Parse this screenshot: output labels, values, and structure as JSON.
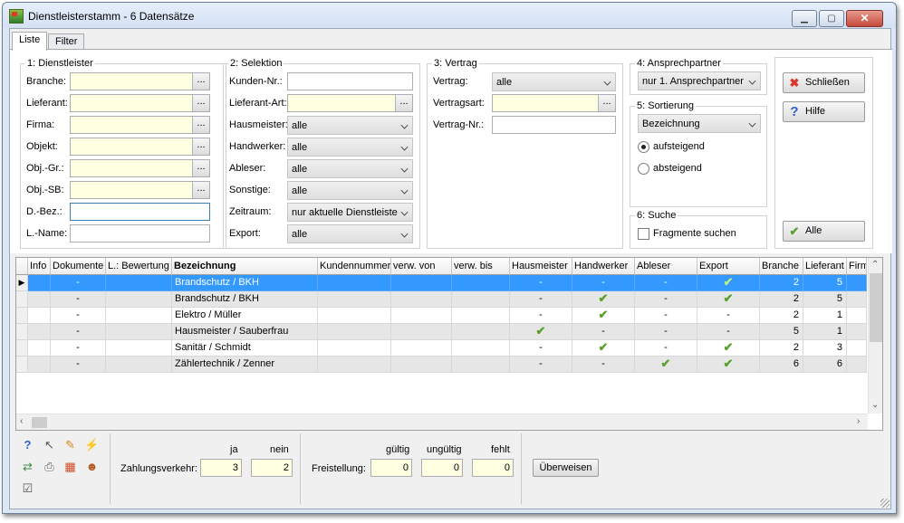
{
  "window": {
    "title": "Dienstleisterstamm - 6 Datensätze",
    "min": "▁",
    "max": "▢",
    "close": "✕"
  },
  "tabs": [
    "Liste",
    "Filter"
  ],
  "groups": {
    "dienstleister": {
      "legend": "1: Dienstleister",
      "fields": [
        {
          "label": "Branche:",
          "value": ""
        },
        {
          "label": "Lieferant:",
          "value": ""
        },
        {
          "label": "Firma:",
          "value": ""
        },
        {
          "label": "Objekt:",
          "value": ""
        },
        {
          "label": "Obj.-Gr.:",
          "value": ""
        },
        {
          "label": "Obj.-SB:",
          "value": ""
        },
        {
          "label": "D.-Bez.:",
          "value": ""
        },
        {
          "label": "L.-Name:",
          "value": ""
        }
      ]
    },
    "selektion": {
      "legend": "2: Selektion",
      "fields": [
        {
          "label": "Kunden-Nr.:",
          "value": ""
        },
        {
          "label": "Lieferant-Art:",
          "value": ""
        },
        {
          "label": "Hausmeister:",
          "value": "alle"
        },
        {
          "label": "Handwerker:",
          "value": "alle"
        },
        {
          "label": "Ableser:",
          "value": "alle"
        },
        {
          "label": "Sonstige:",
          "value": "alle"
        },
        {
          "label": "Zeitraum:",
          "value": "nur aktuelle Dienstleiste"
        },
        {
          "label": "Export:",
          "value": "alle"
        }
      ]
    },
    "vertrag": {
      "legend": "3: Vertrag",
      "fields": [
        {
          "label": "Vertrag:",
          "value": "alle"
        },
        {
          "label": "Vertragsart:",
          "value": ""
        },
        {
          "label": "Vertrag-Nr.:",
          "value": ""
        }
      ]
    },
    "ansprechpartner": {
      "legend": "4: Ansprechpartner",
      "value": "nur 1. Ansprechpartner"
    },
    "sortierung": {
      "legend": "5: Sortierung",
      "value": "Bezeichnung",
      "asc": "aufsteigend",
      "desc": "absteigend"
    },
    "suche": {
      "legend": "6: Suche",
      "checkbox": "Fragmente suchen"
    }
  },
  "buttons": {
    "close": "Schließen",
    "help": "Hilfe",
    "all": "Alle",
    "transfer": "Überweisen",
    "dots": "..."
  },
  "icons": {
    "close": "close-red-x-icon",
    "help": "help-question-icon",
    "all": "green-checkmark-icon"
  },
  "grid": {
    "columns": [
      "Info",
      "Dokumente",
      "L.: Bewertung",
      "Bezeichnung",
      "Kundennummer",
      "verw. von",
      "verw. bis",
      "Hausmeister",
      "Handwerker",
      "Ableser",
      "Export",
      "Branche",
      "Lieferant",
      "Firm"
    ],
    "rows": [
      {
        "info": "",
        "dok": "-",
        "bew": "",
        "bez": "Brandschutz / BKH",
        "kd": "",
        "von": "",
        "bis": "",
        "hm": "-",
        "hw": "-",
        "ab": "-",
        "ex": "✔",
        "br": "2",
        "lf": "5",
        "selected": true
      },
      {
        "info": "",
        "dok": "-",
        "bew": "",
        "bez": "Brandschutz / BKH",
        "kd": "",
        "von": "",
        "bis": "",
        "hm": "-",
        "hw": "✔",
        "ab": "-",
        "ex": "✔",
        "br": "2",
        "lf": "5"
      },
      {
        "info": "",
        "dok": "-",
        "bew": "",
        "bez": "Elektro / Müller",
        "kd": "",
        "von": "",
        "bis": "",
        "hm": "-",
        "hw": "✔",
        "ab": "-",
        "ex": "-",
        "br": "2",
        "lf": "1"
      },
      {
        "info": "",
        "dok": "-",
        "bew": "",
        "bez": "Hausmeister / Sauberfrau",
        "kd": "",
        "von": "",
        "bis": "",
        "hm": "✔",
        "hw": "-",
        "ab": "-",
        "ex": "-",
        "br": "5",
        "lf": "1"
      },
      {
        "info": "",
        "dok": "-",
        "bew": "",
        "bez": "Sanitär / Schmidt",
        "kd": "",
        "von": "",
        "bis": "",
        "hm": "-",
        "hw": "✔",
        "ab": "-",
        "ex": "✔",
        "br": "2",
        "lf": "3"
      },
      {
        "info": "",
        "dok": "-",
        "bew": "",
        "bez": "Zählertechnik / Zenner",
        "kd": "",
        "von": "",
        "bis": "",
        "hm": "-",
        "hw": "-",
        "ab": "✔",
        "ex": "✔",
        "br": "6",
        "lf": "6"
      }
    ]
  },
  "bottom": {
    "zahlungsverkehr": {
      "label": "Zahlungsverkehr:",
      "ja_label": "ja",
      "nein_label": "nein",
      "ja": "3",
      "nein": "2"
    },
    "freistellung": {
      "label": "Freistellung:",
      "gueltig_label": "gültig",
      "ungueltig_label": "ungültig",
      "fehlt_label": "fehlt",
      "gueltig": "0",
      "ungueltig": "0",
      "fehlt": "0"
    }
  },
  "toolbar_icons": [
    "help-icon",
    "pointer-icon",
    "pencil-icon",
    "lightning-icon",
    "refresh-icon",
    "print-icon",
    "layout-icon",
    "users-icon",
    "checkbox-icon"
  ]
}
